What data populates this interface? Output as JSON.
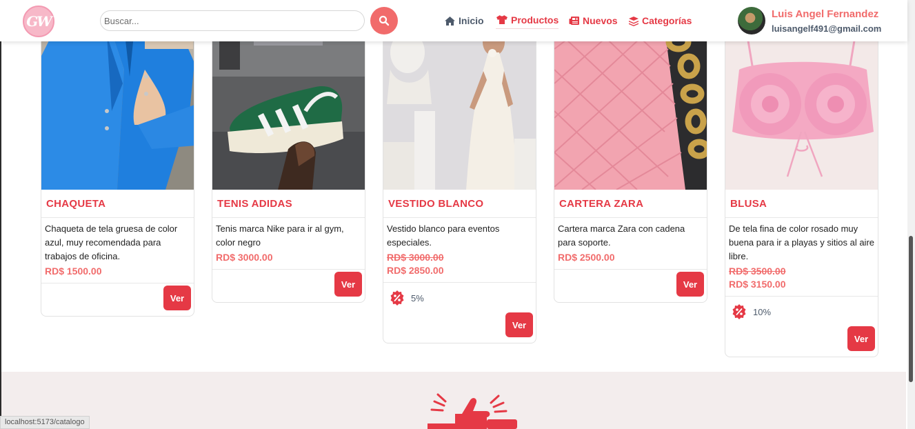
{
  "header": {
    "logo_text": "GW",
    "search_placeholder": "Buscar...",
    "nav": [
      {
        "label": "Inicio",
        "icon": "home-icon"
      },
      {
        "label": "Productos",
        "icon": "shirt-icon"
      },
      {
        "label": "Nuevos",
        "icon": "newspaper-icon"
      },
      {
        "label": "Categorías",
        "icon": "layers-icon"
      }
    ],
    "user": {
      "name": "Luis Angel Fernandez",
      "email": "luisangelf491@gmail.com"
    }
  },
  "products": [
    {
      "title": "CHAQUETA",
      "description": "Chaqueta de tela gruesa de color azul, muy recomendada para trabajos de oficina.",
      "price": "RD$ 1500.00",
      "button": "Ver"
    },
    {
      "title": "TENIS ADIDAS",
      "description": "Tenis marca Nike para ir al gym, color negro",
      "price": "RD$ 3000.00",
      "button": "Ver"
    },
    {
      "title": "VESTIDO BLANCO",
      "description": "Vestido blanco para eventos especiales.",
      "old_price": "RD$ 3000.00",
      "price": "RD$ 2850.00",
      "discount": "5%",
      "button": "Ver"
    },
    {
      "title": "CARTERA ZARA",
      "description": "Cartera marca Zara con cadena para soporte.",
      "price": "RD$ 2500.00",
      "button": "Ver"
    },
    {
      "title": "BLUSA",
      "description": "De tela fina de color rosado muy buena para ir a playas y sitios al aire libre.",
      "old_price": "RD$ 3500.00",
      "price": "RD$ 3150.00",
      "discount": "10%",
      "button": "Ver"
    }
  ],
  "status_bar": {
    "url": "localhost:5173/catalogo"
  },
  "colors": {
    "accent": "#e53945",
    "price": "#f16b6b",
    "muted": "#4d5a6b",
    "footer_bg": "#f3eded"
  }
}
